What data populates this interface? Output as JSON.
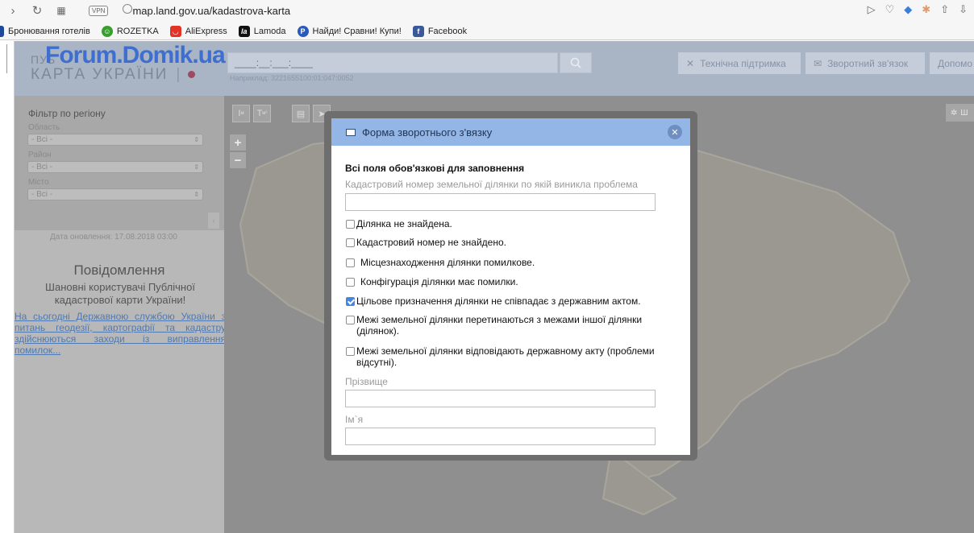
{
  "browser": {
    "url": "map.land.gov.ua/kadastrova-karta",
    "vpn_label": "VPN",
    "bookmarks": [
      {
        "label": "Бронювання готелів",
        "icon": "hotel-icon",
        "color": "#1f4a9a"
      },
      {
        "label": "ROZETKA",
        "icon": "rozetka-icon",
        "color": "#37a02d"
      },
      {
        "label": "AliExpress",
        "icon": "aliexpress-icon",
        "color": "#e43225"
      },
      {
        "label": "Lamoda",
        "icon": "lamoda-icon",
        "color": "#111111"
      },
      {
        "label": "Найди! Сравни! Купи!",
        "icon": "price-icon",
        "color": "#2a5bb8"
      },
      {
        "label": "Facebook",
        "icon": "facebook-icon",
        "color": "#3b5998"
      }
    ]
  },
  "header": {
    "watermark": "Forum.Domik.ua",
    "logo_top": "ПУБ",
    "logo_main": "КАРТА УКРАЇНИ",
    "logo_sep": "|",
    "search_value": "____:__:___:____",
    "search_example": "Наприклад: 3221655100:01:047:0052",
    "buttons": {
      "support": "Технічна підтримка",
      "feedback": "Зворотний зв'язок",
      "help": "Допомо"
    }
  },
  "sidebar": {
    "filter_title": "Фільтр по регіону",
    "labels": {
      "region": "Область",
      "district": "Район",
      "city": "Місто"
    },
    "select_value": "- Всі -",
    "collapse": "‹",
    "update_date": "Дата оновлення: 17.08.2018 03:00",
    "messages_title": "Повідомлення",
    "messages_text": "Шановні користувачі Публічної кадастрової карти України!",
    "messages_link": "На сьогодні Державною службою України з питань геодезії, картографії та кадастру здійснюються заходи із виправлення помилок..."
  },
  "map": {
    "tools": [
      "I м",
      "I м²",
      "print",
      "select"
    ],
    "zoom_in": "+",
    "zoom_out": "−",
    "right_btn": "Ш"
  },
  "modal": {
    "title": "Форма зворотнього з'вязку",
    "required_note": "Всі поля обов'язкові для заповнення",
    "cadastral_label": "Кадастровий номер земельної ділянки по якій виникла проблема",
    "checkboxes": [
      {
        "label": "Ділянка не знайдена.",
        "checked": false
      },
      {
        "label": "Кадастровий номер не знайдено.",
        "checked": false
      },
      {
        "label": "Місцезнаходження ділянки помилкове.",
        "checked": false
      },
      {
        "label": "Конфігурація ділянки має помилки.",
        "checked": false
      },
      {
        "label": "Цільове призначення ділянки не співпадає з державним актом.",
        "checked": true
      },
      {
        "label": "Межі земельної ділянки перетинаються з межами іншої ділянки (ділянок).",
        "checked": false
      },
      {
        "label": "Межі земельної ділянки відповідають державному акту (проблеми відсутні).",
        "checked": false
      }
    ],
    "surname_label": "Прізвище",
    "name_label": "Ім`я"
  }
}
